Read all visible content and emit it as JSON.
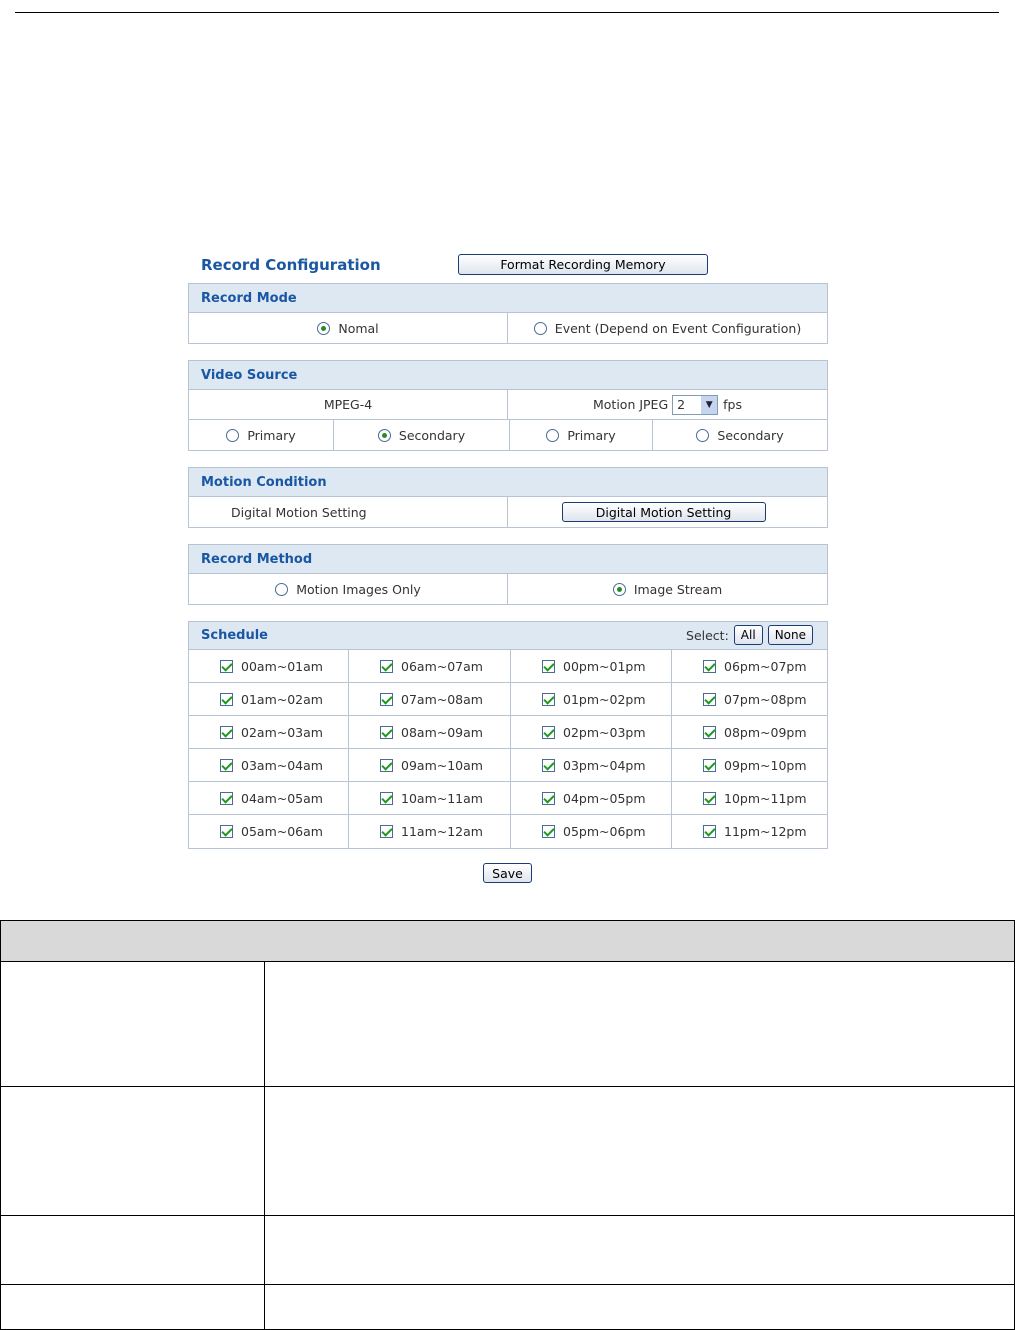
{
  "record_config": {
    "title": "Record Configuration",
    "format_button": "Format Recording Memory"
  },
  "record_mode": {
    "header": "Record Mode",
    "options": [
      {
        "label": "Nomal",
        "selected": true
      },
      {
        "label": "Event (Depend on Event Configuration)",
        "selected": false
      }
    ]
  },
  "video_source": {
    "header": "Video Source",
    "mpeg4_label": "MPEG-4",
    "mjpeg_label": "Motion JPEG",
    "fps_value": "2",
    "fps_unit": "fps",
    "mpeg4_options": [
      {
        "label": "Primary",
        "selected": false
      },
      {
        "label": "Secondary",
        "selected": true
      }
    ],
    "mjpeg_options": [
      {
        "label": "Primary",
        "selected": false
      },
      {
        "label": "Secondary",
        "selected": false
      }
    ]
  },
  "motion_condition": {
    "header": "Motion Condition",
    "label": "Digital Motion Setting",
    "button": "Digital Motion Setting"
  },
  "record_method": {
    "header": "Record Method",
    "options": [
      {
        "label": "Motion Images Only",
        "selected": false
      },
      {
        "label": "Image Stream",
        "selected": true
      }
    ]
  },
  "schedule": {
    "header": "Schedule",
    "select_label": "Select:",
    "all_button": "All",
    "none_button": "None",
    "rows": [
      [
        "00am~01am",
        "06am~07am",
        "00pm~01pm",
        "06pm~07pm"
      ],
      [
        "01am~02am",
        "07am~08am",
        "01pm~02pm",
        "07pm~08pm"
      ],
      [
        "02am~03am",
        "08am~09am",
        "02pm~03pm",
        "08pm~09pm"
      ],
      [
        "03am~04am",
        "09am~10am",
        "03pm~04pm",
        "09pm~10pm"
      ],
      [
        "04am~05am",
        "10am~11am",
        "04pm~05pm",
        "10pm~11pm"
      ],
      [
        "05am~06am",
        "11am~12am",
        "05pm~06pm",
        "11pm~12pm"
      ]
    ],
    "all_checked": true
  },
  "save_button": "Save"
}
